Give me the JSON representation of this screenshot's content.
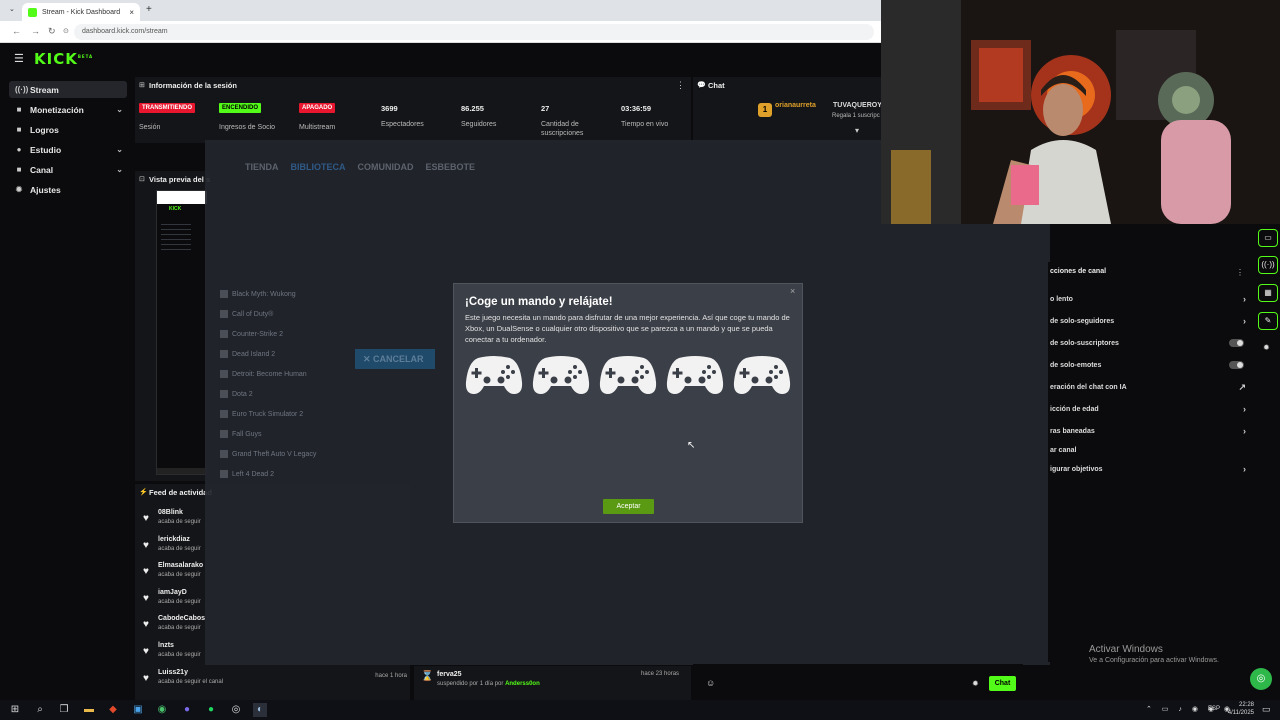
{
  "browser": {
    "tab_title": "Stream - Kick Dashboard",
    "tab_close": "×",
    "new_tab": "+",
    "tab_dropdown": "⌄",
    "url": "dashboard.kick.com/stream"
  },
  "kick": {
    "logo": "KICK",
    "logo_tm": "BETA",
    "sidebar": [
      {
        "label": "Stream",
        "icon": "broadcast-icon",
        "glyph": "((·))",
        "chevron": false,
        "active": true
      },
      {
        "label": "Monetización",
        "icon": "money-icon",
        "glyph": "■",
        "chevron": true,
        "active": false
      },
      {
        "label": "Logros",
        "icon": "trophy-icon",
        "glyph": "■",
        "chevron": false,
        "active": false
      },
      {
        "label": "Estudio",
        "icon": "studio-icon",
        "glyph": "●",
        "chevron": true,
        "active": false
      },
      {
        "label": "Canal",
        "icon": "channel-icon",
        "glyph": "■",
        "chevron": true,
        "active": false
      },
      {
        "label": "Ajustes",
        "icon": "gear-icon",
        "glyph": "✹",
        "chevron": false,
        "active": false
      }
    ],
    "session": {
      "title": "Información de la sesión",
      "menu": "⋮",
      "stats": [
        {
          "badge": "TRANSMITIENDO",
          "badge_color": "#e8162e",
          "label": "Sesión"
        },
        {
          "badge": "ENCENDIDO",
          "badge_color": "#53fc18",
          "label": "Ingresos de Socio"
        },
        {
          "badge": "APAGADO",
          "badge_color": "#e8162e",
          "label": "Multistream"
        },
        {
          "value": "3699",
          "label": "Espectadores"
        },
        {
          "value": "86.255",
          "label": "Seguidores"
        },
        {
          "value": "27",
          "label": "Cantidad de suscripciones"
        },
        {
          "value": "03:36:59",
          "label": "Tiempo en vivo"
        }
      ]
    },
    "preview_title": "Vista previa del s",
    "feed": {
      "title": "Feed de actividad",
      "items": [
        {
          "name": "08Blink",
          "sub": "acaba de seguir"
        },
        {
          "name": "lerickdiaz",
          "sub": "acaba de seguir"
        },
        {
          "name": "Elmasalarako",
          "sub": "acaba de seguir"
        },
        {
          "name": "iamJayD",
          "sub": "acaba de seguir"
        },
        {
          "name": "CabodeCabos",
          "sub": "acaba de seguir"
        },
        {
          "name": "lnzts",
          "sub": "acaba de seguir"
        },
        {
          "name": "Luiss21y",
          "sub": "acaba de seguir el canal",
          "time": "hace 1 hora"
        }
      ]
    },
    "mod_event": {
      "name": "ferva25",
      "text": "suspendido por 1 día por",
      "by": "Anderss0on",
      "time": "hace 23 horas"
    },
    "chat": {
      "title": "Chat",
      "pinned_user": "orianaurreta",
      "pinned_user2": "TUVAQUEROY",
      "pinned_sub": "Regala 1 suscripc",
      "pinned_count": "1",
      "send_label": "Chat"
    }
  },
  "launcher": {
    "tabs": [
      "TIENDA",
      "BIBLIOTECA",
      "COMUNIDAD",
      "ESBEBOTE"
    ],
    "cancel": "CANCELAR",
    "games": [
      "Black Myth: Wukong",
      "Call of Duty®",
      "Counter-Strike 2",
      "Dead Island 2",
      "Detroit: Become Human",
      "Dota 2",
      "Euro Truck Simulator 2",
      "Fall Guys",
      "Grand Theft Auto V Legacy",
      "Left 4 Dead 2"
    ]
  },
  "modal": {
    "title": "¡Coge un mando y relájate!",
    "body": "Este juego necesita un mando para disfrutar de una mejor experiencia. Así que coge tu mando de Xbox, un DualSense o cualquier otro dispositivo que se parezca a un mando y que se pueda conectar a tu ordenador.",
    "close": "×",
    "accept": "Aceptar",
    "pads": [
      "gamepad-icon-1",
      "gamepad-icon-2",
      "gamepad-icon-3",
      "gamepad-icon-4",
      "gamepad-icon-5"
    ]
  },
  "chat_settings": {
    "title": "cciones de canal",
    "rows": [
      {
        "label": "o lento",
        "control": "›"
      },
      {
        "label": "de solo-seguidores",
        "control": "›"
      },
      {
        "label": "de solo-suscriptores",
        "control": "toggle"
      },
      {
        "label": "de solo-emotes",
        "control": "toggle"
      },
      {
        "label": "eración del chat con IA",
        "control": "↗"
      },
      {
        "label": "icción de edad",
        "control": "›"
      },
      {
        "label": "ras baneadas",
        "control": "›"
      },
      {
        "label": "ar canal",
        "control": ""
      },
      {
        "label": "igurar objetivos",
        "control": "›"
      }
    ]
  },
  "windows": {
    "activation_title": "Activar Windows",
    "activation_sub": "Ve a Configuración para activar Windows.",
    "time": "22:28",
    "date": "4/11/2025",
    "lang": "ESP"
  }
}
